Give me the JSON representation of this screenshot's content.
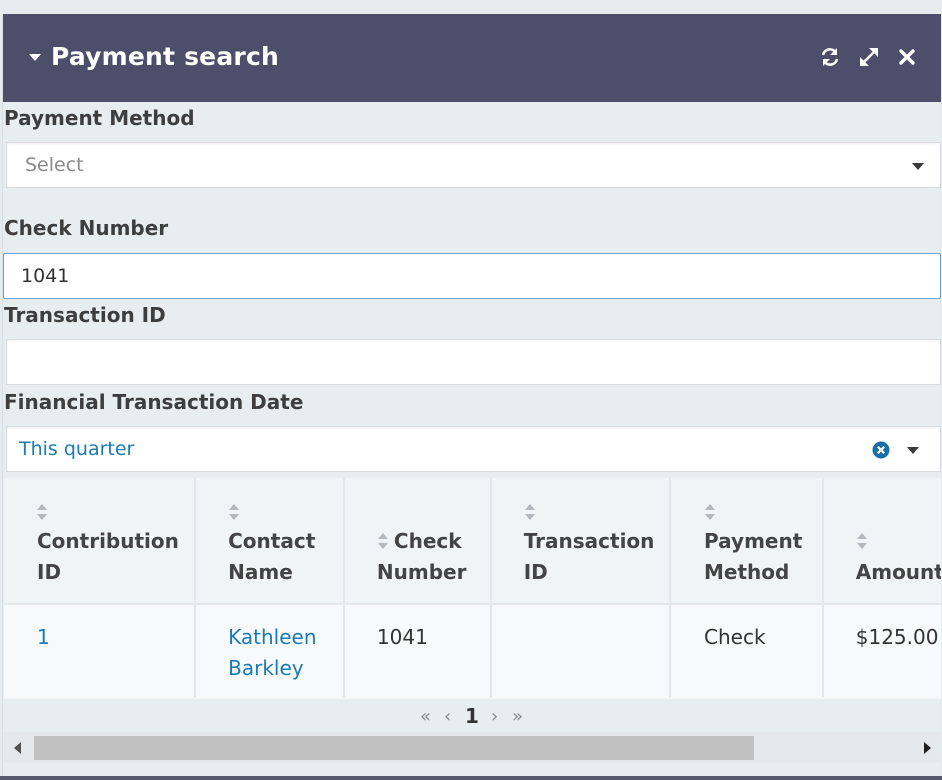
{
  "header": {
    "title": "Payment search",
    "icons": [
      "collapse-caret",
      "refresh-icon",
      "expand-icon",
      "close-icon"
    ]
  },
  "form": {
    "payment_method": {
      "label": "Payment Method",
      "placeholder": "Select",
      "value": ""
    },
    "check_number": {
      "label": "Check Number",
      "value": "1041"
    },
    "transaction_id": {
      "label": "Transaction ID",
      "value": ""
    },
    "financial_transaction_date": {
      "label": "Financial Transaction Date",
      "value": "This quarter"
    }
  },
  "table": {
    "columns": [
      {
        "line1": "Contribution",
        "line2": "ID"
      },
      {
        "line1": "Contact",
        "line2": "Name"
      },
      {
        "line1": "Check",
        "line2": "Number"
      },
      {
        "line1": "Transaction",
        "line2": "ID"
      },
      {
        "line1": "Payment",
        "line2": "Method"
      },
      {
        "line1": "Amount",
        "line2": ""
      }
    ],
    "rows": [
      {
        "contribution_id": "1",
        "contact_name_line1": "Kathleen",
        "contact_name_line2": "Barkley",
        "check_number": "1041",
        "transaction_id": "",
        "payment_method": "Check",
        "amount": "$125.00"
      }
    ]
  },
  "pager": {
    "first": "«",
    "prev": "‹",
    "current": "1",
    "next": "›",
    "last": "»"
  },
  "colors": {
    "header_bg": "#4d4f6a",
    "link": "#1a7bb5",
    "focus_border": "#6fa4cc"
  }
}
